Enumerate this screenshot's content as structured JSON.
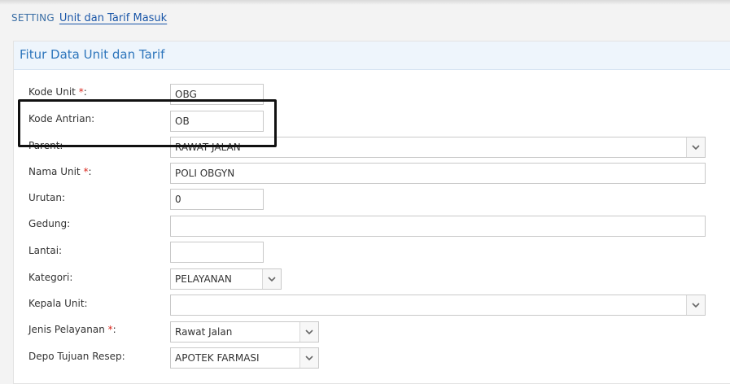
{
  "breadcrumb": {
    "root": "SETTING",
    "current": "Unit dan Tarif Masuk"
  },
  "panel": {
    "title": "Fitur Data Unit dan Tarif"
  },
  "form": {
    "kode_unit": {
      "label": "Kode Unit",
      "required": "*",
      "colon": ":",
      "value": "OBG"
    },
    "kode_antrian": {
      "label": "Kode Antrian:",
      "value": "OB"
    },
    "parent": {
      "label": "Parent:",
      "value": "RAWAT JALAN"
    },
    "nama_unit": {
      "label": "Nama Unit",
      "required": "*",
      "colon": ":",
      "value": "POLI OBGYN"
    },
    "urutan": {
      "label": "Urutan:",
      "value": "0"
    },
    "gedung": {
      "label": "Gedung:",
      "value": ""
    },
    "lantai": {
      "label": "Lantai:",
      "value": ""
    },
    "kategori": {
      "label": "Kategori:",
      "value": "PELAYANAN"
    },
    "kepala_unit": {
      "label": "Kepala Unit:",
      "value": ""
    },
    "jenis_pelayanan": {
      "label": "Jenis Pelayanan",
      "required": "*",
      "colon": ":",
      "value": "Rawat Jalan"
    },
    "depo_tujuan_resep": {
      "label": "Depo Tujuan Resep:",
      "value": "APOTEK FARMASI"
    }
  },
  "icons": {
    "dropdown": "chevron-down-icon"
  },
  "colors": {
    "accent": "#2e76bc",
    "required": "#d9261c",
    "highlight_border": "#111111"
  }
}
